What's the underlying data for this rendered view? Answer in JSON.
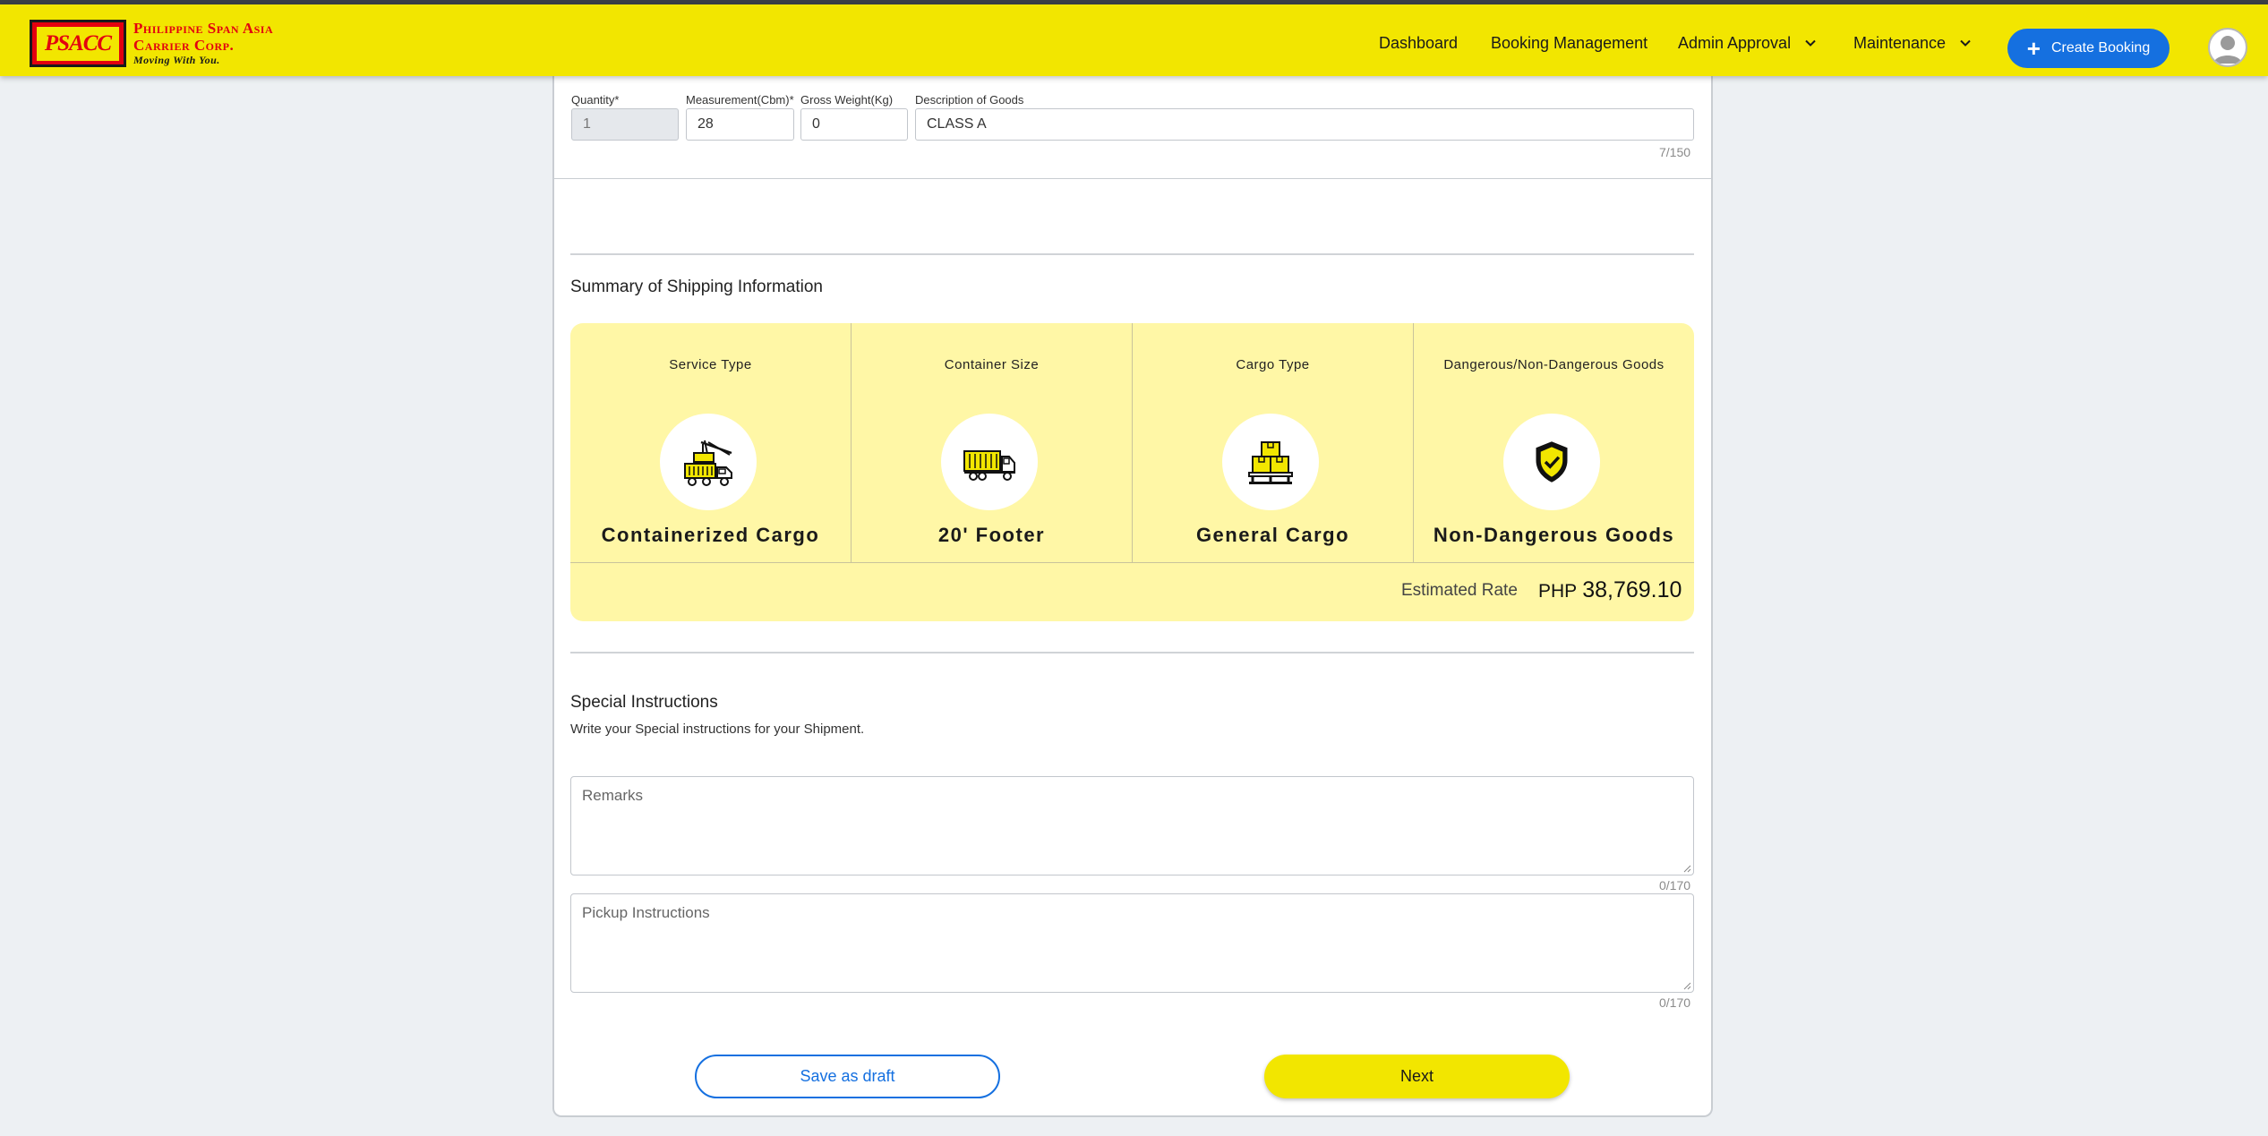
{
  "header": {
    "logo_text": "PSACC",
    "brand_line1": "Philippine Span Asia",
    "brand_line2": "Carrier Corp.",
    "tagline": "Moving With You.",
    "nav": {
      "dashboard": "Dashboard",
      "booking_management": "Booking Management",
      "admin_approval": "Admin Approval",
      "maintenance": "Maintenance"
    },
    "create_booking": "Create Booking"
  },
  "goods_row": {
    "quantity_label": "Quantity*",
    "quantity_value": "1",
    "measurement_label": "Measurement(Cbm)*",
    "measurement_value": "28",
    "gross_weight_label": "Gross Weight(Kg)",
    "gross_weight_value": "0",
    "description_label": "Description of Goods",
    "description_value": "CLASS A",
    "description_counter": "7/150"
  },
  "summary": {
    "title": "Summary of Shipping Information",
    "service_type": {
      "label": "Service Type",
      "value": "Containerized Cargo",
      "icon": "crane-truck-icon"
    },
    "container_size": {
      "label": "Container Size",
      "value": "20' Footer",
      "icon": "container-truck-icon"
    },
    "cargo_type": {
      "label": "Cargo Type",
      "value": "General Cargo",
      "icon": "boxes-pallet-icon"
    },
    "dangerous_goods": {
      "label": "Dangerous/Non-Dangerous Goods",
      "value": "Non-Dangerous Goods",
      "icon": "shield-check-icon"
    },
    "estimated_rate_label": "Estimated Rate",
    "currency": "PHP",
    "estimated_rate_value": "38,769.10",
    "accent_color": "#f2e600",
    "panel_color": "#fff7a6"
  },
  "special_instructions": {
    "title": "Special Instructions",
    "subtitle": "Write your Special instructions for your Shipment.",
    "remarks_placeholder": "Remarks",
    "remarks_counter": "0/170",
    "pickup_placeholder": "Pickup Instructions",
    "pickup_counter": "0/170"
  },
  "actions": {
    "save_draft": "Save as draft",
    "next": "Next"
  }
}
